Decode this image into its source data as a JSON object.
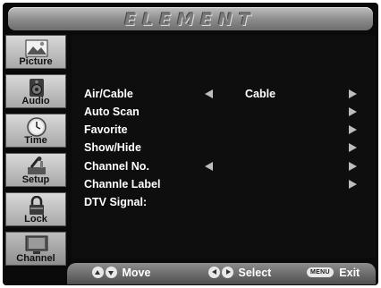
{
  "header": {
    "brand": "ELEMENT"
  },
  "sidebar": {
    "items": [
      {
        "label": "Picture",
        "icon": "picture-icon",
        "active": false
      },
      {
        "label": "Audio",
        "icon": "speaker-icon",
        "active": false
      },
      {
        "label": "Time",
        "icon": "clock-icon",
        "active": false
      },
      {
        "label": "Setup",
        "icon": "tools-icon",
        "active": false
      },
      {
        "label": "Lock",
        "icon": "lock-icon",
        "active": false
      },
      {
        "label": "Channel",
        "icon": "tv-icon",
        "active": true
      }
    ]
  },
  "menu": {
    "rows": [
      {
        "label": "Air/Cable",
        "value": "Cable",
        "left_arrow": true,
        "right_arrow": true
      },
      {
        "label": "Auto Scan",
        "value": "",
        "left_arrow": false,
        "right_arrow": true
      },
      {
        "label": "Favorite",
        "value": "",
        "left_arrow": false,
        "right_arrow": true
      },
      {
        "label": "Show/Hide",
        "value": "",
        "left_arrow": false,
        "right_arrow": true
      },
      {
        "label": "Channel No.",
        "value": "",
        "left_arrow": true,
        "right_arrow": true
      },
      {
        "label": "Channle Label",
        "value": "",
        "left_arrow": false,
        "right_arrow": true
      },
      {
        "label": "DTV Signal:",
        "value": "",
        "left_arrow": false,
        "right_arrow": false
      }
    ]
  },
  "footer": {
    "move_label": "Move",
    "select_label": "Select",
    "menu_key": "MENU",
    "exit_label": "Exit"
  },
  "colors": {
    "background": "#0e0e0e",
    "text": "#ffffff",
    "arrow": "#bdbdbd",
    "sidebar": "#bdbdbd"
  }
}
